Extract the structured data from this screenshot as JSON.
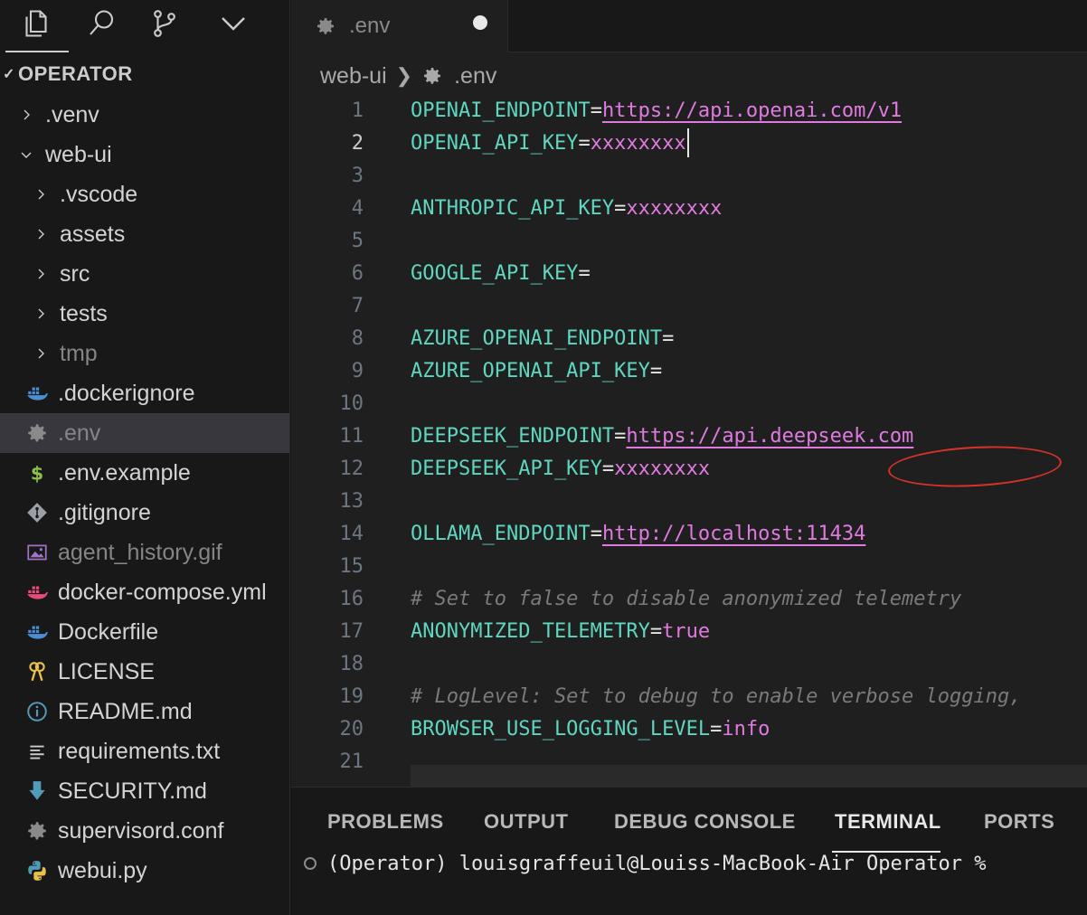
{
  "activity_bar": {
    "icons": [
      "explorer-icon",
      "search-icon",
      "source-control-icon",
      "more-chevron-icon"
    ]
  },
  "explorer": {
    "section_title": "OPERATOR",
    "items": [
      {
        "label": ".venv",
        "type": "folder",
        "expanded": false,
        "indent": 1
      },
      {
        "label": "web-ui",
        "type": "folder",
        "expanded": true,
        "indent": 1
      },
      {
        "label": ".vscode",
        "type": "folder",
        "expanded": false,
        "indent": 2
      },
      {
        "label": "assets",
        "type": "folder",
        "expanded": false,
        "indent": 2
      },
      {
        "label": "src",
        "type": "folder",
        "expanded": false,
        "indent": 2
      },
      {
        "label": "tests",
        "type": "folder",
        "expanded": false,
        "indent": 2
      },
      {
        "label": "tmp",
        "type": "folder",
        "expanded": false,
        "indent": 2,
        "dim": true
      },
      {
        "label": ".dockerignore",
        "type": "file",
        "icon": "docker-icon",
        "indent": 2
      },
      {
        "label": ".env",
        "type": "file",
        "icon": "gear-icon",
        "indent": 2,
        "selected": true,
        "dim": true
      },
      {
        "label": ".env.example",
        "type": "file",
        "icon": "dollar-icon",
        "indent": 2
      },
      {
        "label": ".gitignore",
        "type": "file",
        "icon": "git-icon",
        "indent": 2
      },
      {
        "label": "agent_history.gif",
        "type": "file",
        "icon": "image-icon",
        "indent": 2,
        "dim": true
      },
      {
        "label": "docker-compose.yml",
        "type": "file",
        "icon": "docker-compose-icon",
        "indent": 2
      },
      {
        "label": "Dockerfile",
        "type": "file",
        "icon": "docker-icon",
        "indent": 2
      },
      {
        "label": "LICENSE",
        "type": "file",
        "icon": "license-key-icon",
        "indent": 2
      },
      {
        "label": "README.md",
        "type": "file",
        "icon": "info-icon",
        "indent": 2
      },
      {
        "label": "requirements.txt",
        "type": "file",
        "icon": "text-lines-icon",
        "indent": 2
      },
      {
        "label": "SECURITY.md",
        "type": "file",
        "icon": "download-arrow-icon",
        "indent": 2
      },
      {
        "label": "supervisord.conf",
        "type": "file",
        "icon": "gear-icon",
        "indent": 2
      },
      {
        "label": "webui.py",
        "type": "file",
        "icon": "python-icon",
        "indent": 2
      }
    ]
  },
  "tabs": [
    {
      "label": ".env",
      "icon": "gear-icon",
      "dirty": true
    }
  ],
  "breadcrumb": {
    "folder": "web-ui",
    "file": ".env"
  },
  "editor": {
    "active_line": 2,
    "lines": [
      {
        "n": "1",
        "tokens": [
          {
            "t": "OPENAI_ENDPOINT",
            "c": "k"
          },
          {
            "t": "=",
            "c": "op"
          },
          {
            "t": "https://api.openai.com/v1",
            "c": "url"
          }
        ]
      },
      {
        "n": "2",
        "tokens": [
          {
            "t": "OPENAI_API_KEY",
            "c": "k"
          },
          {
            "t": "=",
            "c": "op"
          },
          {
            "t": "xxxxxxxx",
            "c": "v"
          }
        ],
        "cursor": true
      },
      {
        "n": "3",
        "tokens": []
      },
      {
        "n": "4",
        "tokens": [
          {
            "t": "ANTHROPIC_API_KEY",
            "c": "k"
          },
          {
            "t": "=",
            "c": "op"
          },
          {
            "t": "xxxxxxxx",
            "c": "v"
          }
        ]
      },
      {
        "n": "5",
        "tokens": []
      },
      {
        "n": "6",
        "tokens": [
          {
            "t": "GOOGLE_API_KEY",
            "c": "k"
          },
          {
            "t": "=",
            "c": "op"
          }
        ]
      },
      {
        "n": "7",
        "tokens": []
      },
      {
        "n": "8",
        "tokens": [
          {
            "t": "AZURE_OPENAI_ENDPOINT",
            "c": "k"
          },
          {
            "t": "=",
            "c": "op"
          }
        ]
      },
      {
        "n": "9",
        "tokens": [
          {
            "t": "AZURE_OPENAI_API_KEY",
            "c": "k"
          },
          {
            "t": "=",
            "c": "op"
          }
        ]
      },
      {
        "n": "10",
        "tokens": []
      },
      {
        "n": "11",
        "tokens": [
          {
            "t": "DEEPSEEK_ENDPOINT",
            "c": "k"
          },
          {
            "t": "=",
            "c": "op"
          },
          {
            "t": "https://api.deepseek.com",
            "c": "url"
          }
        ]
      },
      {
        "n": "12",
        "tokens": [
          {
            "t": "DEEPSEEK_API_KEY",
            "c": "k"
          },
          {
            "t": "=",
            "c": "op"
          },
          {
            "t": "xxxxxxxx",
            "c": "v"
          }
        ]
      },
      {
        "n": "13",
        "tokens": []
      },
      {
        "n": "14",
        "tokens": [
          {
            "t": "OLLAMA_ENDPOINT",
            "c": "k"
          },
          {
            "t": "=",
            "c": "op"
          },
          {
            "t": "http://localhost:11434",
            "c": "url"
          }
        ]
      },
      {
        "n": "15",
        "tokens": []
      },
      {
        "n": "16",
        "tokens": [
          {
            "t": "# Set to false to disable anonymized telemetry",
            "c": "com"
          }
        ]
      },
      {
        "n": "17",
        "tokens": [
          {
            "t": "ANONYMIZED_TELEMETRY",
            "c": "k"
          },
          {
            "t": "=",
            "c": "op"
          },
          {
            "t": "true",
            "c": "v"
          }
        ]
      },
      {
        "n": "18",
        "tokens": []
      },
      {
        "n": "19",
        "tokens": [
          {
            "t": "# LogLevel: Set to debug to enable verbose logging,",
            "c": "com"
          }
        ]
      },
      {
        "n": "20",
        "tokens": [
          {
            "t": "BROWSER_USE_LOGGING_LEVEL",
            "c": "k"
          },
          {
            "t": "=",
            "c": "op"
          },
          {
            "t": "info",
            "c": "v"
          }
        ]
      },
      {
        "n": "21",
        "tokens": []
      }
    ]
  },
  "panel": {
    "tabs": [
      "PROBLEMS",
      "OUTPUT",
      "DEBUG CONSOLE",
      "TERMINAL",
      "PORTS"
    ],
    "active_tab": "TERMINAL",
    "terminal_prompt": "(Operator) louisgraffeuil@Louiss-MacBook-Air Operator %"
  },
  "colors": {
    "key": "#5fd7c0",
    "value": "#e07ae0",
    "comment": "#7a7a7a",
    "annotation": "#d7322a",
    "selection": "#37373d"
  }
}
